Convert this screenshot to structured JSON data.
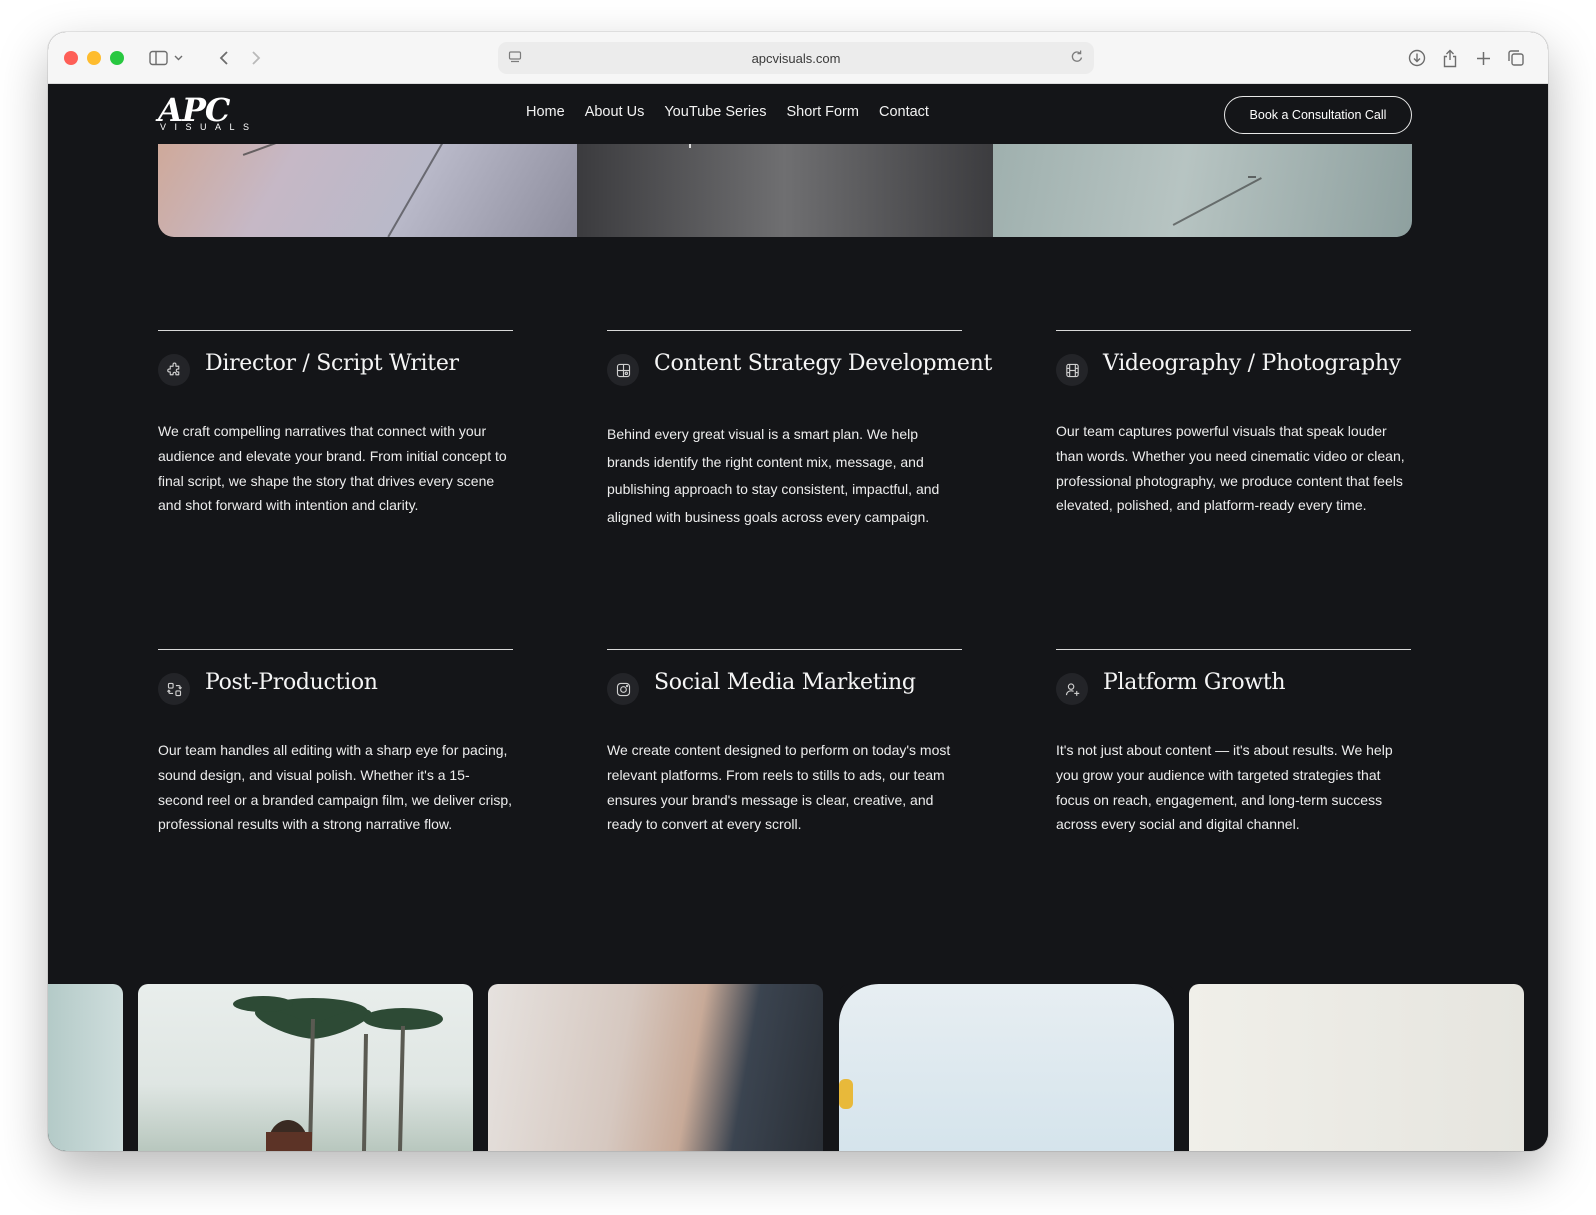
{
  "browser": {
    "url": "apcvisuals.com"
  },
  "site": {
    "logo": {
      "main": "APC",
      "sub": "VISUALS"
    },
    "nav": [
      {
        "label": "Home"
      },
      {
        "label": "About Us"
      },
      {
        "label": "YouTube Series"
      },
      {
        "label": "Short Form"
      },
      {
        "label": "Contact"
      }
    ],
    "cta": "Book a Consultation Call"
  },
  "services": [
    {
      "icon": "puzzle-icon",
      "title": "Director / Script Writer",
      "description": "We craft compelling narratives that connect with your audience and elevate your brand. From initial concept to final script, we shape the story that drives every scene and shot forward with intention and clarity."
    },
    {
      "icon": "strategy-board-icon",
      "title": "Content Strategy Development",
      "description": "Behind every great visual is a smart plan. We help brands identify the right content mix, message, and publishing approach to stay consistent, impactful, and aligned with business goals across every campaign."
    },
    {
      "icon": "film-icon",
      "title": "Videography / Photography",
      "description": "Our team captures powerful visuals that speak louder than words. Whether you need cinematic video or clean, professional photography, we produce content that feels elevated, polished, and platform-ready every time."
    },
    {
      "icon": "edit-transfer-icon",
      "title": "Post-Production",
      "description": "Our team handles all editing with a sharp eye for pacing, sound design, and visual polish. Whether it's a 15-second reel or a branded campaign film, we deliver crisp, professional results with a strong narrative flow."
    },
    {
      "icon": "instagram-icon",
      "title": "Social Media Marketing",
      "description": "We create content designed to perform on today's most relevant platforms. From reels to stills to ads, our team ensures your brand's message is clear, creative, and ready to convert at every scroll."
    },
    {
      "icon": "user-growth-icon",
      "title": "Platform Growth",
      "description": "It's not just about content — it's about results. We help you grow your audience with targeted strategies that focus on reach, engagement, and long-term success across every social and digital channel."
    }
  ]
}
